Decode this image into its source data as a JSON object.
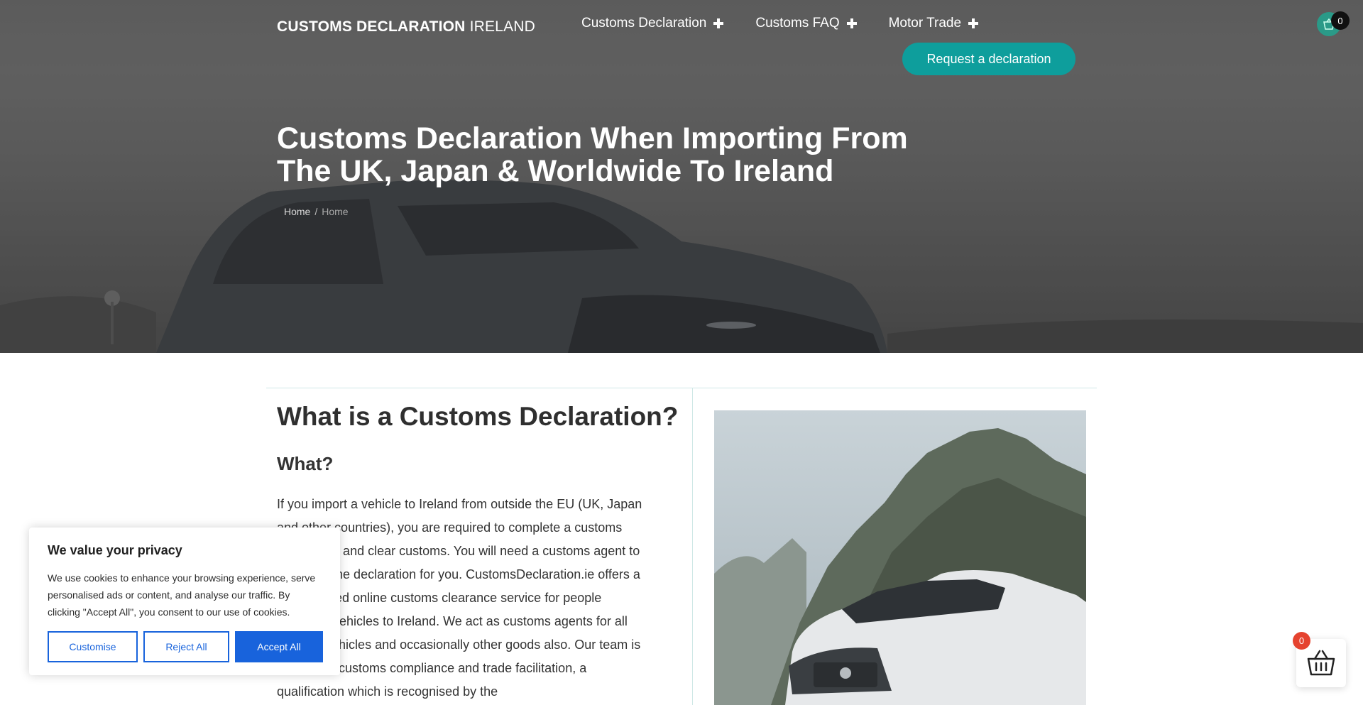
{
  "header": {
    "logo_bold": "CUSTOMS DECLARATION",
    "logo_light": "IRELAND",
    "nav": [
      {
        "label": "Customs Declaration"
      },
      {
        "label": "Customs FAQ"
      },
      {
        "label": "Motor Trade"
      }
    ],
    "cta_label": "Request a declaration",
    "cart_count": "0"
  },
  "hero": {
    "title": "Customs Declaration When Importing From The UK, Japan & Worldwide To Ireland",
    "breadcrumb": [
      "Home",
      "Home"
    ],
    "breadcrumb_separator": "/"
  },
  "main": {
    "heading": "What is a Customs Declaration?",
    "subheading": "What?",
    "body": "If you import a vehicle to Ireland from outside the EU (UK, Japan and other countries), you are required to complete a customs declaration and clear customs. You will need a customs agent to complete the declaration for you. CustomsDeclaration.ie offers a personalised online customs clearance service for people importing vehicles to Ireland. We act as customs agents for all types of vehicles and occasionally other goods also. Our team is certified in customs compliance and trade facilitation, a qualification which is recognised by the"
  },
  "cookie": {
    "title": "We value your privacy",
    "text": "We use cookies to enhance your browsing experience, serve personalised ads or content, and analyse our traffic. By clicking \"Accept All\", you consent to our use of cookies.",
    "customise": "Customise",
    "reject": "Reject All",
    "accept": "Accept All"
  },
  "floating_cart": {
    "count": "0",
    "icon": "basket-icon"
  },
  "colors": {
    "accent": "#0e9e9c",
    "cookie_blue": "#1863dc",
    "badge_red": "#e5432f"
  }
}
